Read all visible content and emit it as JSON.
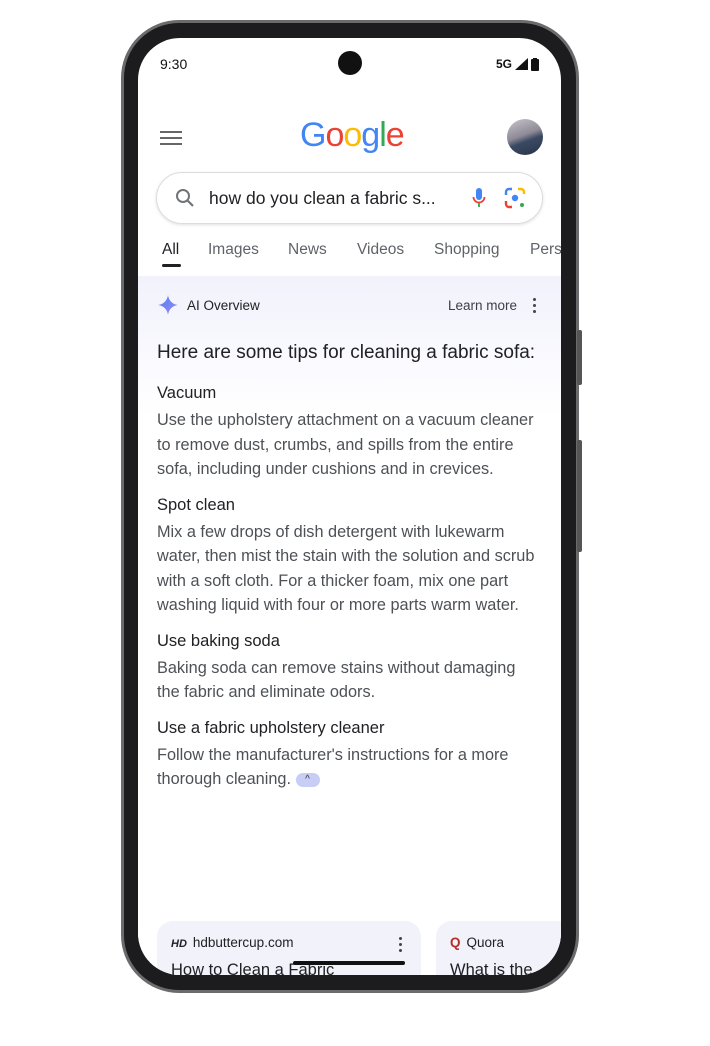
{
  "status": {
    "time": "9:30",
    "network": "5G"
  },
  "header": {
    "logo": "Google",
    "logo_colors": [
      "#4285F4",
      "#EA4335",
      "#FBBC05",
      "#4285F4",
      "#34A853",
      "#EA4335"
    ]
  },
  "search": {
    "query": "how do you clean a fabric s..."
  },
  "tabs": [
    "All",
    "Images",
    "News",
    "Videos",
    "Shopping",
    "Pers"
  ],
  "ai_overview": {
    "label": "AI Overview",
    "learn_more": "Learn more",
    "heading": "Here are some tips for cleaning a fabric sofa:",
    "sections": [
      {
        "title": "Vacuum",
        "text": "Use the upholstery attachment on a vacuum cleaner to remove dust, crumbs, and spills from the entire sofa, including under cushions and in crevices."
      },
      {
        "title": "Spot clean",
        "text": "Mix a few drops of dish detergent with lukewarm water, then mist the stain with the solution and scrub with a soft cloth. For a thicker foam, mix one part washing liquid with four or more parts warm water."
      },
      {
        "title": "Use baking soda",
        "text": "Baking soda can remove stains without damaging the fabric and eliminate odors."
      },
      {
        "title": "Use a fabric upholstery cleaner",
        "text": "Follow the manufacturer's instructions for a more thorough cleaning."
      }
    ]
  },
  "sources": [
    {
      "logo": "HD",
      "site": "hdbuttercup.com",
      "title": "How to Clean a Fabric"
    },
    {
      "logo": "Q",
      "site": "Quora",
      "title": "What is the"
    }
  ]
}
